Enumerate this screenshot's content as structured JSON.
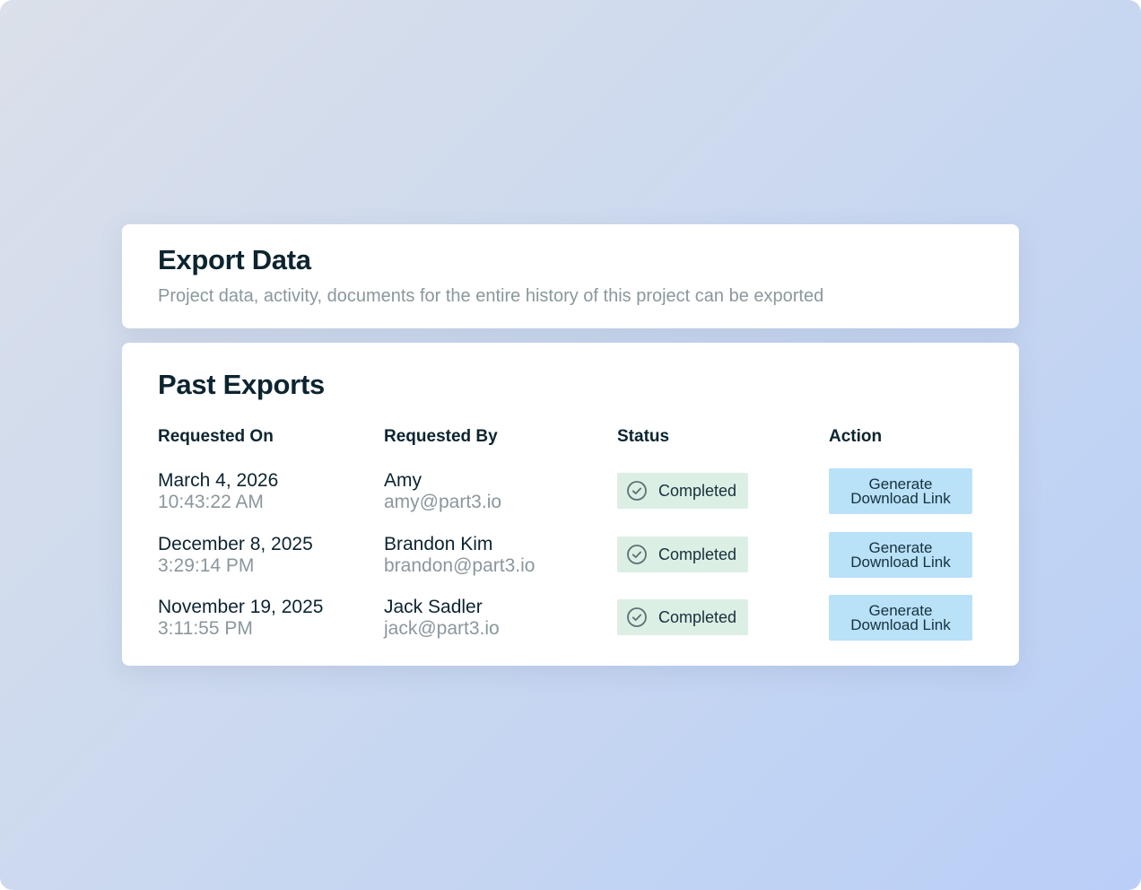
{
  "export_card": {
    "title": "Export Data",
    "subtitle": "Project data, activity, documents for the entire history of this project can be exported"
  },
  "past_exports": {
    "title": "Past Exports",
    "columns": [
      "Requested On",
      "Requested By",
      "Status",
      "Action"
    ],
    "rows": [
      {
        "date": "March 4, 2026",
        "time": "10:43:22 AM",
        "name": "Amy",
        "email": "amy@part3.io",
        "status": "Completed",
        "action": "Generate Download Link"
      },
      {
        "date": "December 8, 2025",
        "time": "3:29:14 PM",
        "name": "Brandon Kim",
        "email": "brandon@part3.io",
        "status": "Completed",
        "action": "Generate Download Link"
      },
      {
        "date": "November 19, 2025",
        "time": "3:11:55 PM",
        "name": "Jack Sadler",
        "email": "jack@part3.io",
        "status": "Completed",
        "action": "Generate Download Link"
      }
    ]
  },
  "icons": {
    "status": "check-circle-icon"
  },
  "colors": {
    "status_badge_bg": "#dcefe4",
    "action_button_bg": "#b9e1f8",
    "heading_text": "#0c2430",
    "muted_text": "#8a979d"
  }
}
